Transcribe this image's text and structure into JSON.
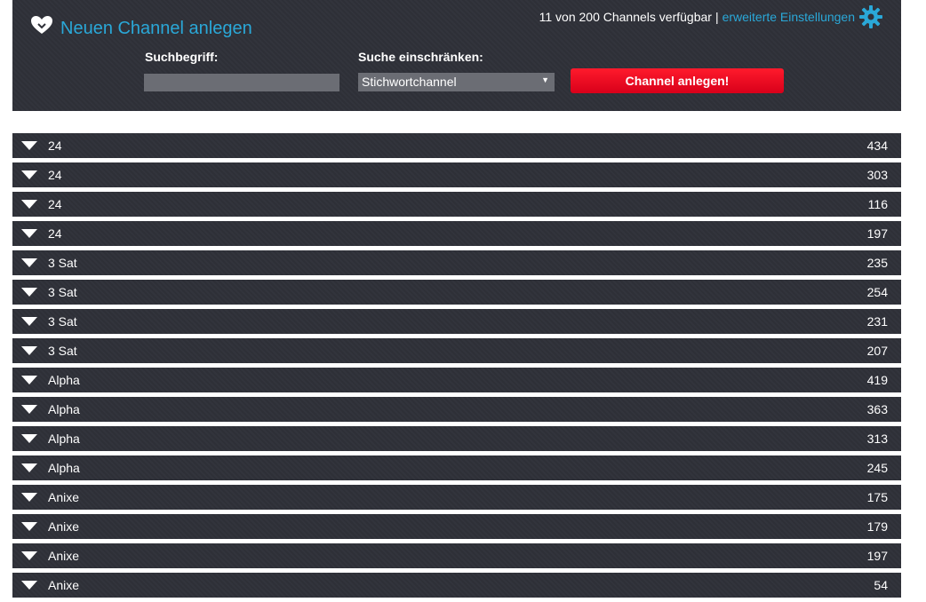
{
  "header": {
    "title": "Neuen Channel anlegen",
    "availability": "11 von 200 Channels verfügbar",
    "separator": "|",
    "advanced_link": "erweiterte Einstellungen"
  },
  "form": {
    "search_label": "Suchbegriff:",
    "search_value": "",
    "restrict_label": "Suche einschränken:",
    "restrict_selected": "Stichwortchannel",
    "submit_label": "Channel anlegen!"
  },
  "colors": {
    "accent": "#2aa8d8",
    "button": "#e8001e",
    "panel": "#2f3139"
  },
  "channels": [
    {
      "name": "24",
      "count": "434"
    },
    {
      "name": "24",
      "count": "303"
    },
    {
      "name": "24",
      "count": "116"
    },
    {
      "name": "24",
      "count": "197"
    },
    {
      "name": "3 Sat",
      "count": "235"
    },
    {
      "name": "3 Sat",
      "count": "254"
    },
    {
      "name": "3 Sat",
      "count": "231"
    },
    {
      "name": "3 Sat",
      "count": "207"
    },
    {
      "name": "Alpha",
      "count": "419"
    },
    {
      "name": "Alpha",
      "count": "363"
    },
    {
      "name": "Alpha",
      "count": "313"
    },
    {
      "name": "Alpha",
      "count": "245"
    },
    {
      "name": "Anixe",
      "count": "175"
    },
    {
      "name": "Anixe",
      "count": "179"
    },
    {
      "name": "Anixe",
      "count": "197"
    },
    {
      "name": "Anixe",
      "count": "54"
    }
  ]
}
